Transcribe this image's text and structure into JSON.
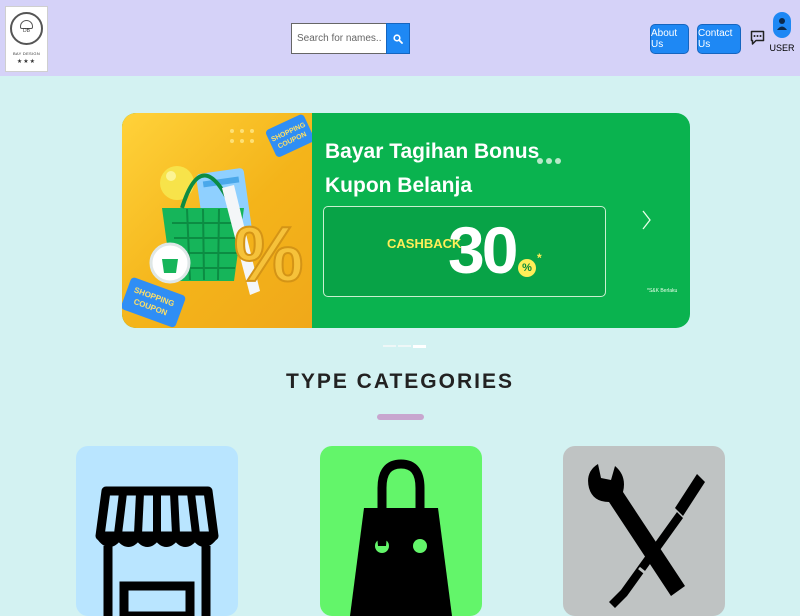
{
  "header": {
    "logo": {
      "icon": "hat-logo-icon",
      "line1": "DB",
      "line2": "BAY DESIGN",
      "stars": "★★★"
    },
    "search": {
      "placeholder": "Search for names..",
      "icon": "search-icon"
    },
    "nav": {
      "about_label": "About Us",
      "contact_label": "Contact Us"
    },
    "chat_icon": "chat-icon",
    "user": {
      "icon": "user-icon",
      "label": "USER"
    }
  },
  "banner": {
    "title_line1": "Bayar Tagihan Bonus",
    "title_line2": "Kupon Belanja",
    "cashback_label": "CASHBACK",
    "cashback_value": "30",
    "percent": "%",
    "asterisk": "*",
    "disclaimer": "*S&K Berlaku",
    "next_icon": "chevron-right-icon",
    "slides": 3,
    "active_slide": 3,
    "colors": {
      "green": "#0ab34f",
      "yellow": "#ffd23a",
      "accent": "#ffee58"
    }
  },
  "categories": {
    "title": "TYPE CATEGORIES",
    "underline_color": "#c8a6cf",
    "cards": [
      {
        "icon": "store-icon",
        "color": "#b9e5ff"
      },
      {
        "icon": "shopping-bag-icon",
        "color": "#63f56a"
      },
      {
        "icon": "tools-icon",
        "color": "#bfc3c3"
      }
    ]
  },
  "colors": {
    "header_bg": "#d5d2f8",
    "page_bg": "#d3f2f2",
    "primary_button": "#1e88f4"
  }
}
